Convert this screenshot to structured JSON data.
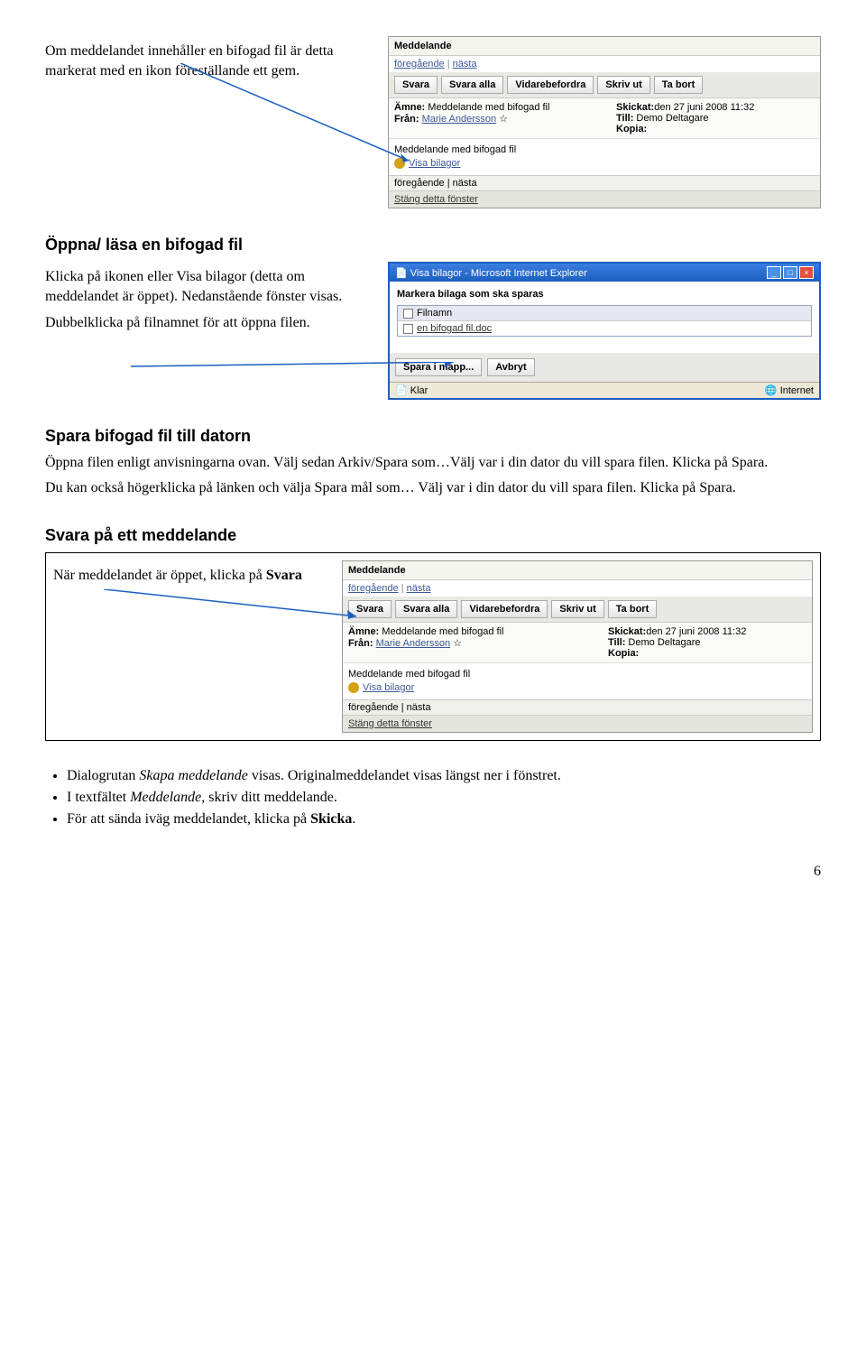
{
  "section1": {
    "para": "Om meddelandet innehåller en bifogad fil är detta markerat med en ikon föreställande ett gem."
  },
  "section2": {
    "heading": "Öppna/ läsa en bifogad fil",
    "para1a": "Klicka på ikonen eller Visa bilagor (detta om meddelandet är öppet). Nedanstående fönster visas.",
    "para2": "Dubbelklicka på filnamnet för att öppna filen."
  },
  "section3": {
    "heading": "Spara bifogad fil till datorn",
    "para1": "Öppna filen enligt anvisningarna ovan. Välj sedan Arkiv/Spara som…Välj var i din dator du vill spara filen. Klicka på Spara.",
    "para2": "Du kan också högerklicka på länken och välja Spara mål som… Välj var i din dator du vill spara filen. Klicka på Spara."
  },
  "section4": {
    "heading": "Svara på ett meddelande",
    "para1a": "När meddelandet är öppet, klicka på ",
    "para1b": "Svara"
  },
  "bullets": {
    "b1a": "Dialogrutan ",
    "b1b": "Skapa meddelande",
    "b1c": " visas. Originalmeddelandet visas längst ner i fönstret.",
    "b2a": "I textfältet ",
    "b2b": "Meddelande",
    "b2c": ", skriv ditt meddelande.",
    "b3a": "För att sända iväg meddelandet, klicka på ",
    "b3b": "Skicka",
    "b3c": "."
  },
  "msg": {
    "title": "Meddelande",
    "prev": "föregående",
    "next": "nästa",
    "svara": "Svara",
    "svara_alla": "Svara alla",
    "vidare": "Vidarebefordra",
    "skriv_ut": "Skriv ut",
    "ta_bort": "Ta bort",
    "amne_label": "Ämne:",
    "amne_val": "Meddelande med bifogad fil",
    "fran_label": "Från:",
    "fran_val": "Marie Andersson",
    "skickat_label": "Skickat:",
    "skickat_val": "den 27 juni 2008 11:32",
    "till_label": "Till:",
    "till_val": "Demo Deltagare",
    "kopia_label": "Kopia:",
    "body_text": "Meddelande med bifogad fil",
    "visa_bilagor": "Visa bilagor",
    "stang": "Stäng detta fönster"
  },
  "ie": {
    "title": "Visa bilagor - Microsoft Internet Explorer",
    "heading": "Markera bilaga som ska sparas",
    "col": "Filnamn",
    "file": "en bifogad fil.doc",
    "spara": "Spara i mapp...",
    "avbryt": "Avbryt",
    "status_left": "Klar",
    "status_right": "Internet"
  },
  "page_num": "6"
}
